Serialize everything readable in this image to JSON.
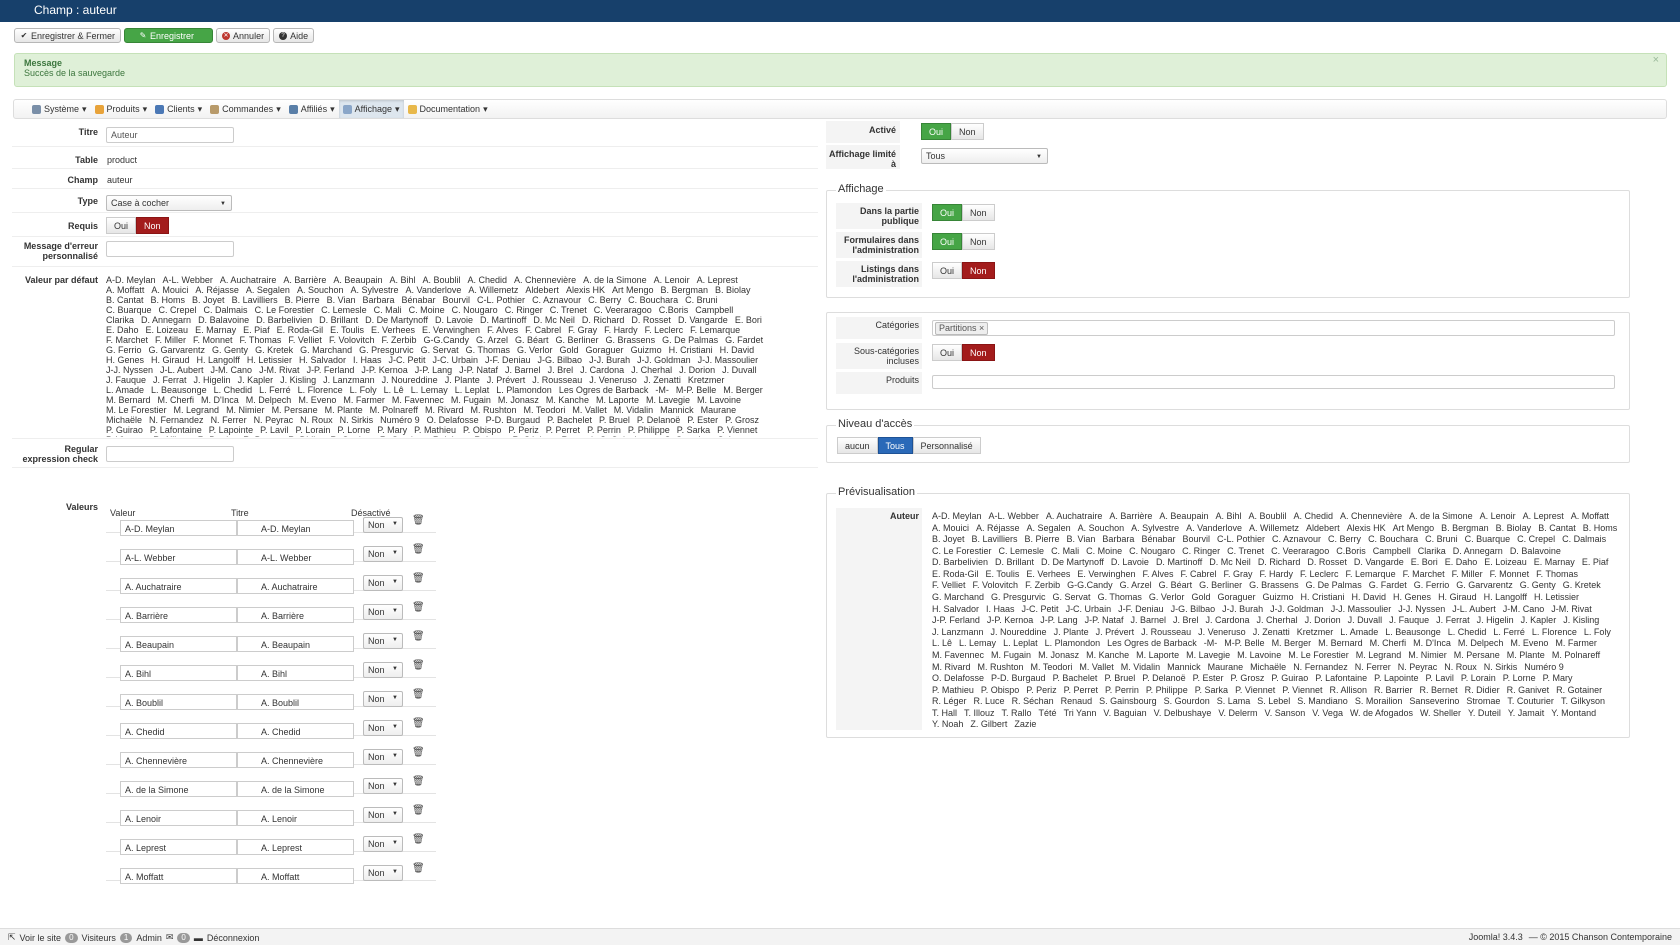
{
  "page_title": "Champ : auteur",
  "toolbar": {
    "save_close": "Enregistrer & Fermer",
    "save": "Enregistrer",
    "cancel": "Annuler",
    "help": "Aide"
  },
  "message": {
    "title": "Message",
    "body": "Succès de la sauvegarde",
    "close": "×"
  },
  "menu": [
    "Système",
    "Produits",
    "Clients",
    "Commandes",
    "Affiliés",
    "Affichage",
    "Documentation"
  ],
  "form": {
    "titre_label": "Titre",
    "titre_value": "Auteur",
    "table_label": "Table",
    "table_value": "product",
    "champ_label": "Champ",
    "champ_value": "auteur",
    "type_label": "Type",
    "type_value": "Case à cocher",
    "requis_label": "Requis",
    "oui": "Oui",
    "non": "Non",
    "err_label1": "Message d'erreur",
    "err_label2": "personnalisé",
    "defaut_label": "Valeur par défaut",
    "regex_label1": "Regular",
    "regex_label2": "expression check",
    "valeurs_label": "Valeurs",
    "col_valeur": "Valeur",
    "col_titre": "Titre",
    "col_desactive": "Désactivé"
  },
  "names": [
    "A-D. Meylan",
    "A-L. Webber",
    "A. Auchatraire",
    "A. Barrière",
    "A. Beaupain",
    "A. Bihl",
    "A. Boublil",
    "A. Chedid",
    "A. Chennevière",
    "A. de la Simone",
    "A. Lenoir",
    "A. Leprest",
    "A. Moffatt",
    "A. Mouici",
    "A. Réjasse",
    "A. Segalen",
    "A. Souchon",
    "A. Sylvestre",
    "A. Vanderlove",
    "A. Willemetz",
    "Aldebert",
    "Alexis HK",
    "Art Mengo",
    "B. Bergman",
    "B. Biolay",
    "B. Cantat",
    "B. Homs",
    "B. Joyet",
    "B. Lavilliers",
    "B. Pierre",
    "B. Vian",
    "Barbara",
    "Bénabar",
    "Bourvil",
    "C-L. Pothier",
    "C. Aznavour",
    "C. Berry",
    "C. Bouchara",
    "C. Bruni",
    "C. Buarque",
    "C. Crepel",
    "C. Dalmais",
    "C. Le Forestier",
    "C. Lemesle",
    "C. Mali",
    "C. Moine",
    "C. Nougaro",
    "C. Ringer",
    "C. Trenet",
    "C. Veeraragoo",
    "C.Boris",
    "Campbell",
    "Clarika",
    "D. Annegarn",
    "D. Balavoine",
    "D. Barbelivien",
    "D. Brillant",
    "D. De Martynoff",
    "D. Lavoie",
    "D. Martinoff",
    "D. Mc Neil",
    "D. Richard",
    "D. Rosset",
    "D. Vangarde",
    "E. Bori",
    "E. Daho",
    "E. Loizeau",
    "E. Marnay",
    "E. Piaf",
    "E. Roda-Gil",
    "E. Toulis",
    "E. Verhees",
    "E. Verwinghen",
    "F. Alves",
    "F. Cabrel",
    "F. Gray",
    "F. Hardy",
    "F. Leclerc",
    "F. Lemarque",
    "F. Marchet",
    "F. Miller",
    "F. Monnet",
    "F. Thomas",
    "F. Velliet",
    "F. Volovitch",
    "F. Zerbib",
    "G-G.Candy",
    "G. Arzel",
    "G. Béart",
    "G. Berliner",
    "G. Brassens",
    "G. De Palmas",
    "G. Fardet",
    "G. Ferrio",
    "G. Garvarentz",
    "G. Genty",
    "G. Kretek",
    "G. Marchand",
    "G. Presgurvic",
    "G. Servat",
    "G. Thomas",
    "G. Verlor",
    "Gold",
    "Goraguer",
    "Guizmo",
    "H. Cristiani",
    "H. David",
    "H. Genes",
    "H. Giraud",
    "H. Langolff",
    "H. Letissier",
    "H. Salvador",
    "I. Haas",
    "J-C. Petit",
    "J-C. Urbain",
    "J-F. Deniau",
    "J-G. Bilbao",
    "J-J. Burah",
    "J-J. Goldman",
    "J-J. Massoulier",
    "J-J. Nyssen",
    "J-L. Aubert",
    "J-M. Cano",
    "J-M. Rivat",
    "J-P. Ferland",
    "J-P. Kernoa",
    "J-P. Lang",
    "J-P. Nataf",
    "J. Barnel",
    "J. Brel",
    "J. Cardona",
    "J. Cherhal",
    "J. Dorion",
    "J. Duvall",
    "J. Fauque",
    "J. Ferrat",
    "J. Higelin",
    "J. Kapler",
    "J. Kisling",
    "J. Lanzmann",
    "J. Noureddine",
    "J. Plante",
    "J. Prévert",
    "J. Rousseau",
    "J. Veneruso",
    "J. Zenatti",
    "Kretzmer",
    "L. Amade",
    "L. Beausonge",
    "L. Chedid",
    "L. Ferré",
    "L. Florence",
    "L. Foly",
    "L. Lê",
    "L. Lemay",
    "L. Leplat",
    "L. Plamondon",
    "Les Ogres de Barback",
    "-M-",
    "M-P. Belle",
    "M. Berger",
    "M. Bernard",
    "M. Cherfi",
    "M. D'Inca",
    "M. Delpech",
    "M. Eveno",
    "M. Farmer",
    "M. Favennec",
    "M. Fugain",
    "M. Jonasz",
    "M. Kanche",
    "M. Laporte",
    "M. Lavegie",
    "M. Lavoine",
    "M. Le Forestier",
    "M. Legrand",
    "M. Nimier",
    "M. Persane",
    "M. Plante",
    "M. Polnareff",
    "M. Rivard",
    "M. Rushton",
    "M. Teodori",
    "M. Vallet",
    "M. Vidalin",
    "Mannick",
    "Maurane",
    "Michaële",
    "N. Fernandez",
    "N. Ferrer",
    "N. Peyrac",
    "N. Roux",
    "N. Sirkis",
    "Numéro 9",
    "O. Delafosse",
    "P-D. Burgaud",
    "P. Bachelet",
    "P. Bruel",
    "P. Delanoë",
    "P. Ester",
    "P. Grosz",
    "P. Guirao",
    "P. Lafontaine",
    "P. Lapointe",
    "P. Lavil",
    "P. Lorain",
    "P. Lorne",
    "P. Mary",
    "P. Mathieu",
    "P. Obispo",
    "P. Periz",
    "P. Perret",
    "P. Perrin",
    "P. Philippe",
    "P. Sarka",
    "P. Viennet",
    "P. Viennet",
    "R. Allison",
    "R. Barrier",
    "R. Bernet",
    "R. Didier",
    "R. Ganivet",
    "R. Gotainer",
    "R. Léger",
    "R. Luce",
    "R. Séchan",
    "Renaud",
    "S. Gainsbourg",
    "S. Gourdon",
    "S. Lama",
    "S. Lebel",
    "S. Mandiano",
    "S. Morailion",
    "Sanseverino",
    "Stromae",
    "T. Couturier",
    "T. Gilkyson",
    "T. Hall",
    "T. Illouz",
    "T. Rallo",
    "Tété",
    "Tri Yann",
    "V. Baguian",
    "V. Delbushaye",
    "V. Delerm",
    "V. Sanson",
    "V. Vega",
    "W. de Afogados",
    "W. Sheller",
    "Y. Duteil",
    "Y. Jamait",
    "Y. Montand",
    "Y. Noah",
    "Z. Gilbert",
    "Zazie"
  ],
  "values": [
    {
      "v": "A-D. Meylan",
      "t": "A-D. Meylan",
      "d": "Non"
    },
    {
      "v": "A-L. Webber",
      "t": "A-L. Webber",
      "d": "Non"
    },
    {
      "v": "A. Auchatraire",
      "t": "A. Auchatraire",
      "d": "Non"
    },
    {
      "v": "A. Barrière",
      "t": "A. Barrière",
      "d": "Non"
    },
    {
      "v": "A. Beaupain",
      "t": "A. Beaupain",
      "d": "Non"
    },
    {
      "v": "A. Bihl",
      "t": "A. Bihl",
      "d": "Non"
    },
    {
      "v": "A. Boublil",
      "t": "A. Boublil",
      "d": "Non"
    },
    {
      "v": "A. Chedid",
      "t": "A. Chedid",
      "d": "Non"
    },
    {
      "v": "A. Chennevière",
      "t": "A. Chennevière",
      "d": "Non"
    },
    {
      "v": "A. de la Simone",
      "t": "A. de la Simone",
      "d": "Non"
    },
    {
      "v": "A. Lenoir",
      "t": "A. Lenoir",
      "d": "Non"
    },
    {
      "v": "A. Leprest",
      "t": "A. Leprest",
      "d": "Non"
    },
    {
      "v": "A. Moffatt",
      "t": "A. Moffatt",
      "d": "Non"
    }
  ],
  "right": {
    "active_label": "Activé",
    "limit_label": "Affichage limité à",
    "limit_value": "Tous",
    "affichage_legend": "Affichage",
    "public1": "Dans la partie",
    "public2": "publique",
    "forms1": "Formulaires dans",
    "forms2": "l'administration",
    "lists1": "Listings dans",
    "lists2": "l'administration",
    "cat_label": "Catégories",
    "cat_tag": "Partitions",
    "cat_tag_x": "×",
    "subcat1": "Sous-catégories",
    "subcat2": "incluses",
    "products_label": "Produits",
    "acces_legend": "Niveau d'accès",
    "acces": [
      "aucun",
      "Tous",
      "Personnalisé"
    ],
    "preview_legend": "Prévisualisation",
    "preview_label": "Auteur"
  },
  "footer": {
    "site": "Voir le site",
    "visitors_count": "0",
    "visitors": "Visiteurs",
    "admin_count": "1",
    "admin": "Admin",
    "msg_count": "0",
    "logout": "Déconnexion",
    "version": "Joomla! 3.4.3",
    "copyright": "— © 2015 Chanson Contemporaine"
  }
}
